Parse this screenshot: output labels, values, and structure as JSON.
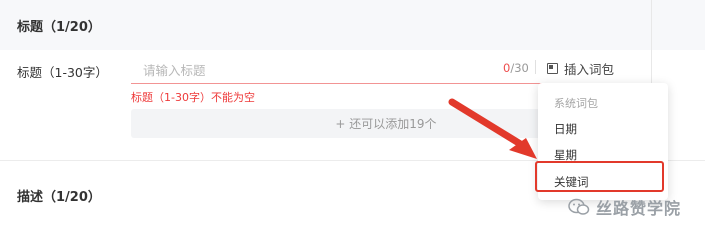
{
  "sections": {
    "title_section": "标题（1/20）",
    "desc_section": "描述（1/20）"
  },
  "title_field": {
    "label": "标题（1-30字）",
    "placeholder": "请输入标题",
    "count_current": "0",
    "count_max": "/30",
    "insert_label": "插入词包",
    "error": "标题（1-30字）不能为空",
    "add_label": "+ 还可以添加19个"
  },
  "dropdown": {
    "header": "系统词包",
    "items": [
      "日期",
      "星期",
      "关键词"
    ],
    "highlighted": "关键词"
  },
  "colors": {
    "error": "#ee3a3a",
    "arrow": "#e2392b"
  },
  "watermark": {
    "text": "丝路赞学院",
    "icon": "wechat-icon"
  }
}
